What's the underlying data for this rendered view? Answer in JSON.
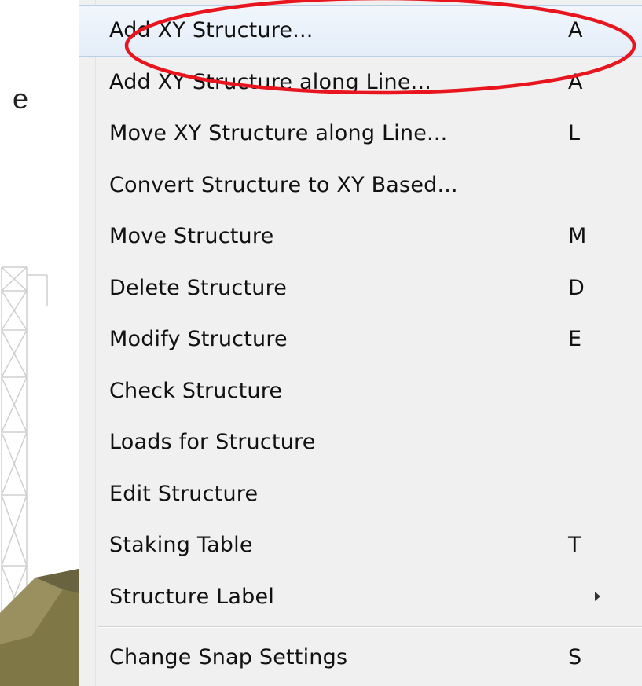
{
  "background": {
    "partial_text": "e"
  },
  "menu": {
    "items": [
      {
        "label": "Add XY Structure...",
        "shortcut": "A",
        "highlighted": true,
        "submenu": false
      },
      {
        "label": "Add XY Structure along Line...",
        "shortcut": "A",
        "highlighted": false,
        "submenu": false
      },
      {
        "label": "Move XY Structure along Line...",
        "shortcut": "L",
        "highlighted": false,
        "submenu": false
      },
      {
        "label": "Convert Structure to XY Based...",
        "shortcut": "",
        "highlighted": false,
        "submenu": false
      },
      {
        "label": "Move Structure",
        "shortcut": "M",
        "highlighted": false,
        "submenu": false
      },
      {
        "label": "Delete Structure",
        "shortcut": "D",
        "highlighted": false,
        "submenu": false
      },
      {
        "label": "Modify Structure",
        "shortcut": "E",
        "highlighted": false,
        "submenu": false
      },
      {
        "label": "Check Structure",
        "shortcut": "",
        "highlighted": false,
        "submenu": false
      },
      {
        "label": "Loads for Structure",
        "shortcut": "",
        "highlighted": false,
        "submenu": false
      },
      {
        "label": "Edit Structure",
        "shortcut": "",
        "highlighted": false,
        "submenu": false
      },
      {
        "label": "Staking Table",
        "shortcut": "T",
        "highlighted": false,
        "submenu": false
      },
      {
        "label": "Structure Label",
        "shortcut": "",
        "highlighted": false,
        "submenu": true
      }
    ],
    "after_separator": [
      {
        "label": "Change Snap Settings",
        "shortcut": "S",
        "highlighted": false,
        "submenu": false
      }
    ]
  },
  "colors": {
    "menu_background": "#f0f0f0",
    "highlight_border": "#b8cfe9",
    "annotation_red": "#e8141e",
    "text": "#111111"
  },
  "icons": {
    "submenu_arrow": "triangle-right-icon",
    "annotation": "red-ellipse-highlight"
  }
}
